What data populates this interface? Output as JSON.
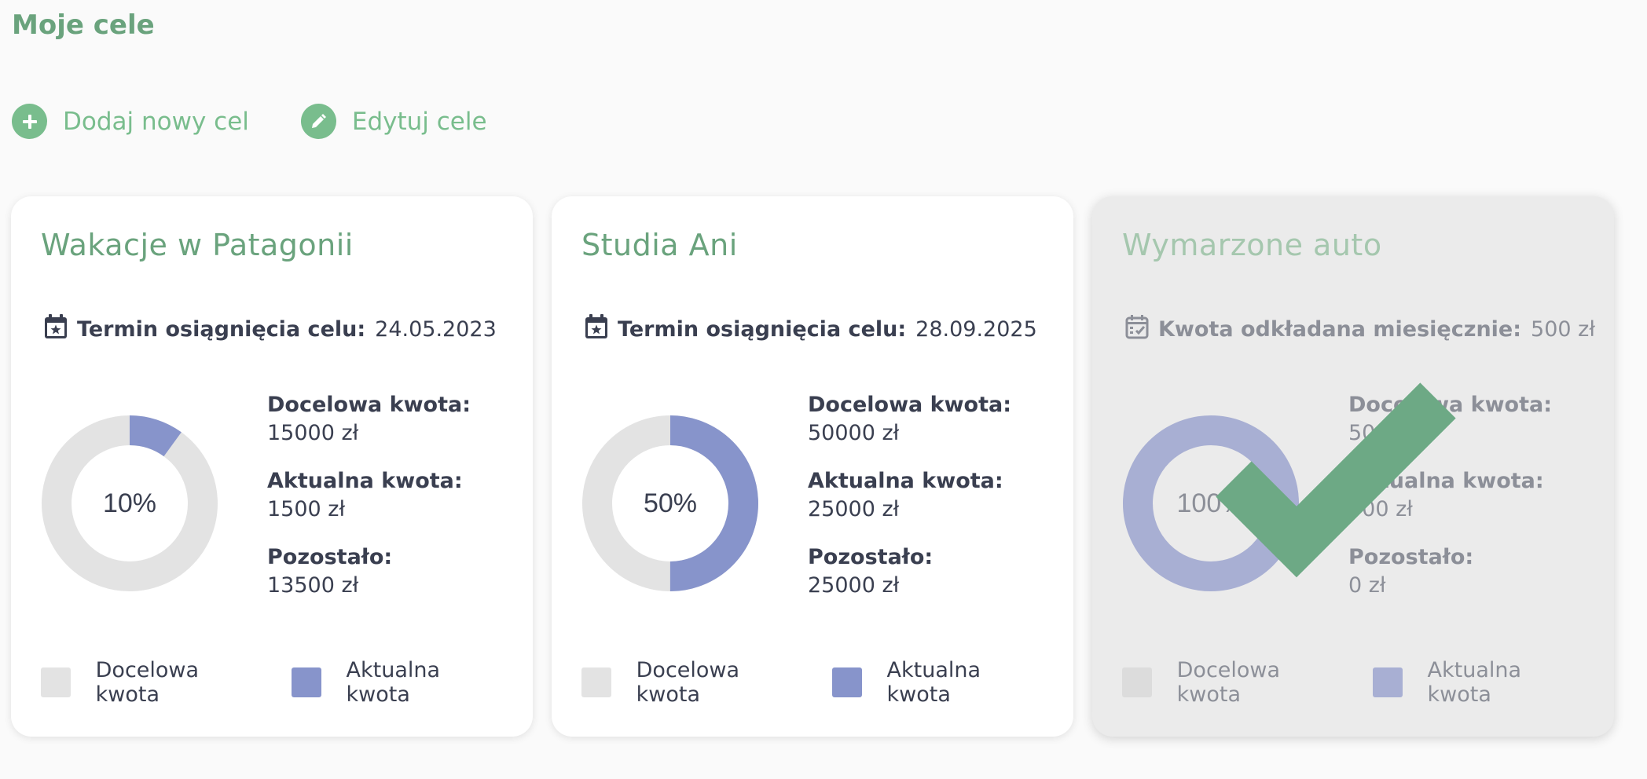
{
  "page": {
    "title": "Moje cele"
  },
  "actions": {
    "add_label": "Dodaj nowy cel",
    "edit_label": "Edytuj cele"
  },
  "colors": {
    "accent": "#6aa37d",
    "action_green": "#79bd8d",
    "target_gray": "#e3e3e3",
    "current_blue": "#8794cb",
    "check_green": "#6da985"
  },
  "goals": [
    {
      "title": "Wakacje w Patagonii",
      "meta_label": "Termin osiągnięcia celu:",
      "meta_value": "24.05.2023",
      "meta_icon": "calendar-star-icon",
      "percent": 10,
      "percent_label": "10%",
      "target_label": "Docelowa kwota:",
      "target_value": "15000 zł",
      "current_label": "Aktualna kwota:",
      "current_value": "1500 zł",
      "remaining_label": "Pozostało:",
      "remaining_value": "13500 zł",
      "legend_target": "Docelowa kwota",
      "legend_current": "Aktualna kwota",
      "completed": false
    },
    {
      "title": "Studia Ani",
      "meta_label": "Termin osiągnięcia celu:",
      "meta_value": "28.09.2025",
      "meta_icon": "calendar-star-icon",
      "percent": 50,
      "percent_label": "50%",
      "target_label": "Docelowa kwota:",
      "target_value": "50000 zł",
      "current_label": "Aktualna kwota:",
      "current_value": "25000 zł",
      "remaining_label": "Pozostało:",
      "remaining_value": "25000 zł",
      "legend_target": "Docelowa kwota",
      "legend_current": "Aktualna kwota",
      "completed": false
    },
    {
      "title": "Wymarzone auto",
      "meta_label": "Kwota odkładana miesięcznie:",
      "meta_value": "500 zł",
      "meta_icon": "calendar-check-icon",
      "percent": 100,
      "percent_label": "100%",
      "target_label": "Docelowa kwota:",
      "target_value": "500",
      "current_label": "Aktualna kwota:",
      "current_value": "500 zł",
      "remaining_label": "Pozostało:",
      "remaining_value": "0 zł",
      "legend_target": "Docelowa kwota",
      "legend_current": "Aktualna kwota",
      "completed": true
    }
  ]
}
